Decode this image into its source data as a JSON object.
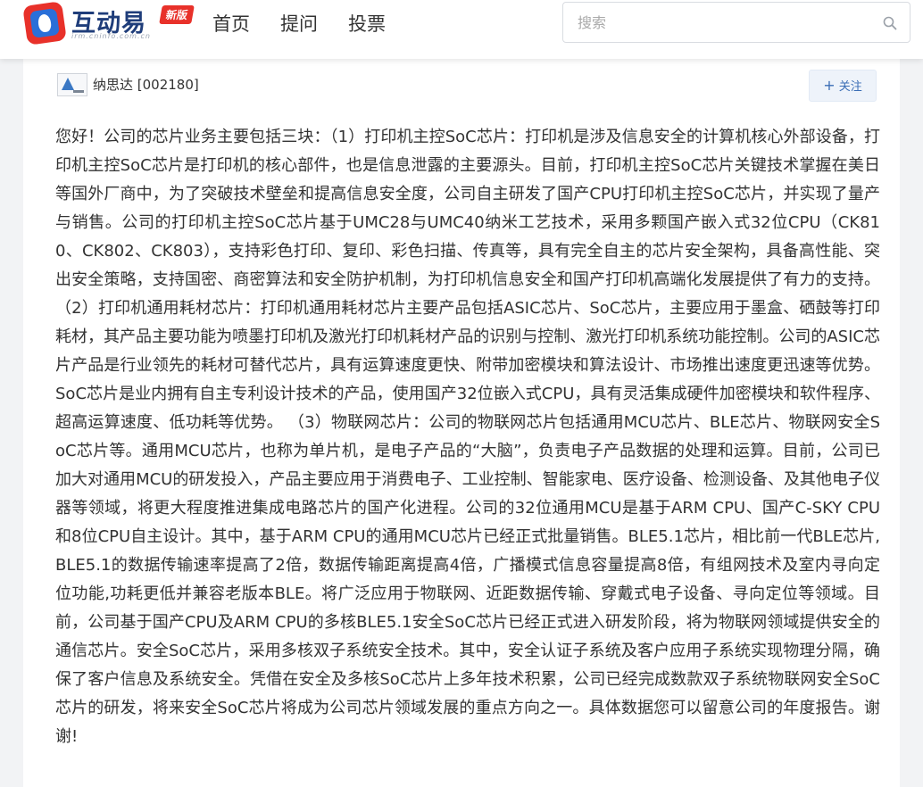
{
  "header": {
    "logo_text": "互动易",
    "logo_badge": "新版",
    "logo_url": "irm.cninfo.com.cn",
    "nav": [
      {
        "label": "首页"
      },
      {
        "label": "提问"
      },
      {
        "label": "投票"
      }
    ],
    "search": {
      "placeholder": "搜索",
      "value": ""
    }
  },
  "post": {
    "author": "纳思达 [002180]",
    "follow_label": "关注",
    "answer": "您好！公司的芯片业务主要包括三块：（1）打印机主控SoC芯片：打印机是涉及信息安全的计算机核心外部设备，打印机主控SoC芯片是打印机的核心部件，也是信息泄露的主要源头。目前，打印机主控SoC芯片关键技术掌握在美日等国外厂商中，为了突破技术壁垒和提高信息安全度，公司自主研发了国产CPU打印机主控SoC芯片，并实现了量产与销售。公司的打印机主控SoC芯片基于UMC28与UMC40纳米工艺技术，采用多颗国产嵌入式32位CPU（CK810、CK802、CK803），支持彩色打印、复印、彩色扫描、传真等，具有完全自主的芯片安全架构，具备高性能、突出安全策略，支持国密、商密算法和安全防护机制，为打印机信息安全和国产打印机高端化发展提供了有力的支持。 （2）打印机通用耗材芯片：打印机通用耗材芯片主要产品包括ASIC芯片、SoC芯片，主要应用于墨盒、硒鼓等打印耗材，其产品主要功能为喷墨打印机及激光打印机耗材产品的识别与控制、激光打印机系统功能控制。公司的ASIC芯片产品是行业领先的耗材可替代芯片，具有运算速度更快、附带加密模块和算法设计、市场推出速度更迅速等优势。SoC芯片是业内拥有自主专利设计技术的产品，使用国产32位嵌入式CPU，具有灵活集成硬件加密模块和软件程序、超高运算速度、低功耗等优势。 （3）物联网芯片：公司的物联网芯片包括通用MCU芯片、BLE芯片、物联网安全SoC芯片等。通用MCU芯片，也称为单片机，是电子产品的“大脑”，负责电子产品数据的处理和运算。目前，公司已加大对通用MCU的研发投入，产品主要应用于消费电子、工业控制、智能家电、医疗设备、检测设备、及其他电子仪器等领域，将更大程度推进集成电路芯片的国产化进程。公司的32位通用MCU是基于ARM CPU、国产C-SKY CPU和8位CPU自主设计。其中，基于ARM CPU的通用MCU芯片已经正式批量销售。BLE5.1芯片，相比前一代BLE芯片, BLE5.1的数据传输速率提高了2倍，数据传输距离提高4倍，广播模式信息容量提高8倍，有组网技术及室内寻向定位功能,功耗更低并兼容老版本BLE。将广泛应用于物联网、近距数据传输、穿戴式电子设备、寻向定位等领域。目前，公司基于国产CPU及ARM CPU的多核BLE5.1安全SoC芯片已经正式进入研发阶段，将为物联网领域提供安全的通信芯片。安全SoC芯片，采用多核双子系统安全技术。其中，安全认证子系统及客户应用子系统实现物理分隔，确保了客户信息及系统安全。凭借在安全及多核SoC芯片上多年技术积累，公司已经完成数款双子系统物联网安全SoC芯片的研发，将来安全SoC芯片将成为公司芯片领域发展的重点方向之一。具体数据您可以留意公司的年度报告。谢谢!"
  },
  "colors": {
    "accent": "#3a6db5",
    "brand_red": "#e8312a",
    "brand_blue": "#1f3d7a",
    "page_bg": "#f2f3f5"
  },
  "icons": {
    "search": "magnifier-icon",
    "follow": "plus-icon"
  }
}
